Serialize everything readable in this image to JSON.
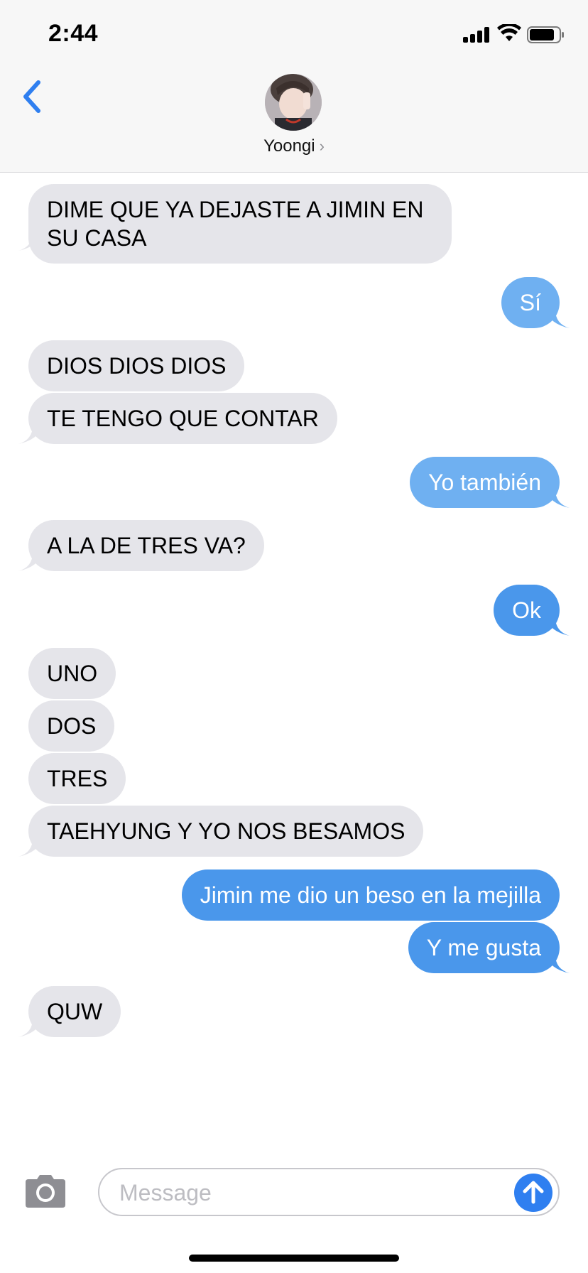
{
  "status_bar": {
    "time": "2:44"
  },
  "header": {
    "contact_name": "Yoongi",
    "chevron": "›"
  },
  "messages": [
    {
      "from": "them",
      "text": "DIME QUE YA DEJASTE A JIMIN EN SU CASA"
    },
    {
      "from": "me",
      "text": "Sí"
    },
    {
      "from": "them",
      "text": "DIOS DIOS DIOS"
    },
    {
      "from": "them",
      "text": "TE TENGO QUE CONTAR"
    },
    {
      "from": "me",
      "text": "Yo también"
    },
    {
      "from": "them",
      "text": "A LA DE TRES VA?"
    },
    {
      "from": "me",
      "text": "Ok"
    },
    {
      "from": "them",
      "text": "UNO"
    },
    {
      "from": "them",
      "text": "DOS"
    },
    {
      "from": "them",
      "text": "TRES"
    },
    {
      "from": "them",
      "text": "TAEHYUNG Y YO NOS BESAMOS"
    },
    {
      "from": "me",
      "text": "Jimin me dio un beso en la mejilla"
    },
    {
      "from": "me",
      "text": "Y me gusta"
    },
    {
      "from": "them",
      "text": "QUW"
    }
  ],
  "input": {
    "placeholder": "Message",
    "value": ""
  },
  "icons": {
    "back": "chevron-left-icon",
    "camera": "camera-icon",
    "send": "arrow-up-icon"
  },
  "colors": {
    "incoming_bubble": "#e5e5ea",
    "outgoing_bubble": "#4a97eb",
    "accent": "#2f7ff0"
  }
}
